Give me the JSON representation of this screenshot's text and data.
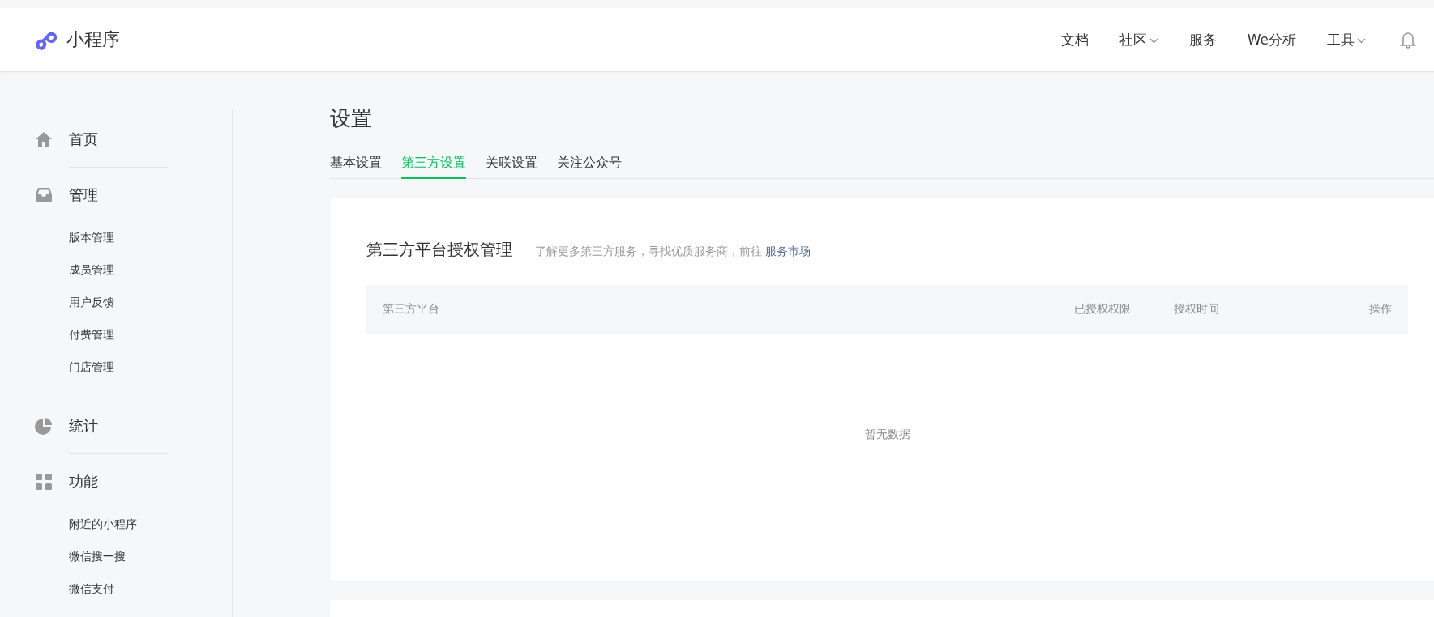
{
  "header": {
    "logo_text": "小程序",
    "nav": [
      {
        "label": "文档",
        "dropdown": false
      },
      {
        "label": "社区",
        "dropdown": true
      },
      {
        "label": "服务",
        "dropdown": false
      },
      {
        "label": "We分析",
        "dropdown": false
      },
      {
        "label": "工具",
        "dropdown": true
      }
    ]
  },
  "sidebar": {
    "sections": [
      {
        "kind": "home",
        "label": "首页"
      },
      {
        "kind": "inbox",
        "label": "管理",
        "children": [
          {
            "label": "版本管理"
          },
          {
            "label": "成员管理"
          },
          {
            "label": "用户反馈"
          },
          {
            "label": "付费管理"
          },
          {
            "label": "门店管理"
          }
        ]
      },
      {
        "kind": "chart",
        "label": "统计"
      },
      {
        "kind": "grid",
        "label": "功能",
        "children": [
          {
            "label": "附近的小程序"
          },
          {
            "label": "微信搜一搜"
          },
          {
            "label": "微信支付"
          }
        ]
      }
    ]
  },
  "page": {
    "title": "设置",
    "tabs": [
      {
        "label": "基本设置",
        "selected": false
      },
      {
        "label": "第三方设置",
        "selected": true
      },
      {
        "label": "关联设置",
        "selected": false
      },
      {
        "label": "关注公众号",
        "selected": false
      }
    ]
  },
  "card": {
    "title": "第三方平台授权管理",
    "hint": "了解更多第三方服务，寻找优质服务商，前往",
    "link": "服务市场",
    "table": {
      "columns": [
        "第三方平台",
        "已授权权限",
        "授权时间",
        "操作"
      ],
      "empty_text": "暂无数据"
    }
  }
}
